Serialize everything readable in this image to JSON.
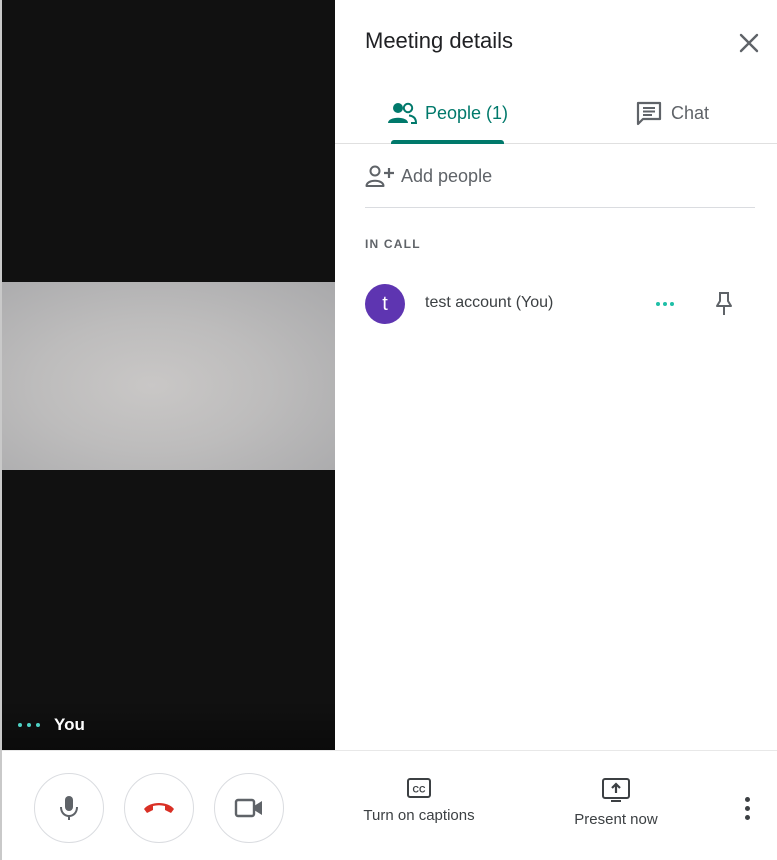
{
  "self_view": {
    "name_label": "You"
  },
  "panel": {
    "title": "Meeting details",
    "tabs": [
      {
        "label": "People (1)",
        "icon": "people-icon",
        "active": true
      },
      {
        "label": "Chat",
        "icon": "chat-icon",
        "active": false
      }
    ],
    "add_people_label": "Add people",
    "section_label": "IN CALL",
    "participants": [
      {
        "initial": "t",
        "name": "test account (You)",
        "avatar_color": "#5e35b1"
      }
    ]
  },
  "controls": {
    "captions_label": "Turn on captions",
    "present_label": "Present now"
  },
  "colors": {
    "accent": "#00796b",
    "hangup": "#d93025",
    "avatar": "#5e35b1"
  }
}
